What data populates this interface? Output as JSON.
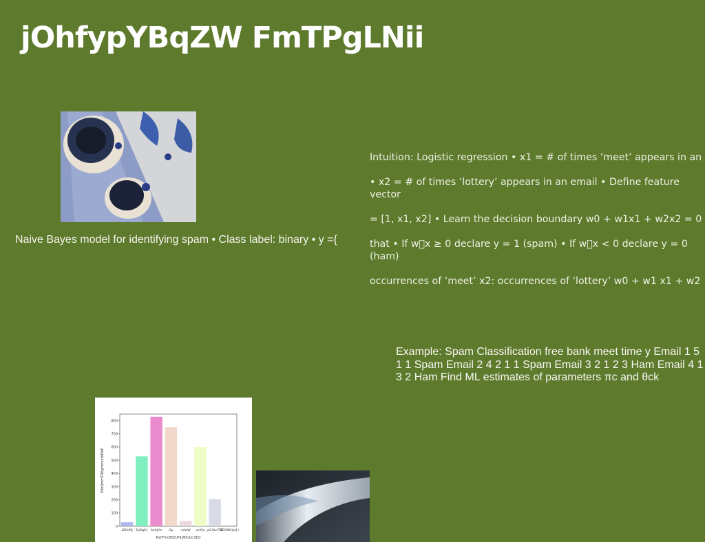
{
  "page": {
    "title": "jOhfypYBqZW FmTPgLNii",
    "background_color": "#5e7a2c"
  },
  "images": {
    "cups_photo": "blue tea cups on tray photo",
    "wave_photo": "abstract silver wave photo"
  },
  "captions": {
    "naive_bayes": "Naive Bayes model for identifying spam • Class label: binary • y ={"
  },
  "blocks": {
    "intuition_lines": [
      "Intuition: Logistic regression • x1 = # of times ‘meet’ appears in an",
      "• x2 = # of times ‘lottery’ appears in an email • Define feature vector",
      "= [1, x1, x2] • Learn the decision boundary w0 + w1x1 + w2x2 = 0",
      "that • If w\u0000x ≥ 0 declare y = 1 (spam) • If w\u0000x < 0 declare y = 0 (ham)",
      "occurrences of ‘meet’ x2: occurrences of ‘lottery’ w0 + w1 x1 + w2"
    ],
    "example": "Example: Spam Classification free bank meet time y Email 1 5 1 1 Spam Email 2 4 2 1 1 Spam Email 3 2 1 2 3 Ham Email 4 1 3 2 Ham Find ML estimates of parameters πc and θck"
  },
  "chart_data": {
    "type": "bar",
    "categories": [
      "tZhUNj",
      "EpRgHr",
      "AeAjHe",
      "Gp",
      "vVwW",
      "xcIOz",
      "jeCALcFSB",
      "EGOWHpQ i"
    ],
    "values": [
      30,
      530,
      830,
      750,
      40,
      600,
      205,
      0
    ],
    "colors": [
      "#aeb8ee",
      "#7eefbe",
      "#e98bcc",
      "#f1d8cb",
      "#ecd8de",
      "#eefcc6",
      "#d8dae6",
      "#ffffff"
    ],
    "xlabel": "KVrFmcBQlUHLWSzLCUEd",
    "ylabel": "EdzQmmTRKgmmurlbEwF",
    "ylim": [
      0,
      850
    ],
    "yticks": [
      0,
      100,
      200,
      300,
      400,
      500,
      600,
      700,
      800
    ]
  }
}
